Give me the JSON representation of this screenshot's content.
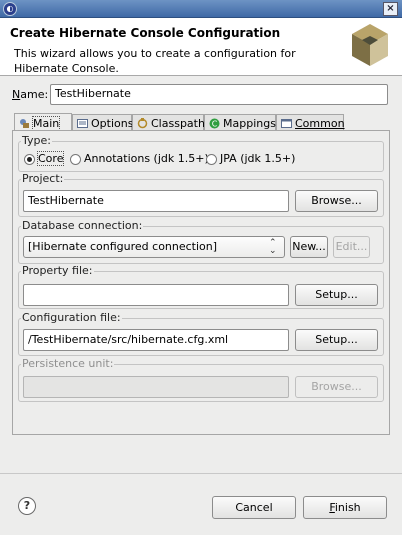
{
  "window": {
    "close_glyph": "×"
  },
  "banner": {
    "title": "Create Hibernate Console Configuration",
    "description": "This wizard allows you to create a configuration for Hibernate Console."
  },
  "name": {
    "label": "Name:",
    "value": "TestHibernate"
  },
  "tabs": [
    {
      "label": "Main",
      "icon": "main-config-icon",
      "active": true
    },
    {
      "label": "Options",
      "icon": "options-icon",
      "active": false
    },
    {
      "label": "Classpath",
      "icon": "classpath-icon",
      "active": false
    },
    {
      "label": "Mappings",
      "icon": "mappings-icon",
      "active": false
    },
    {
      "label": "Common",
      "icon": "common-icon",
      "active": false
    }
  ],
  "type": {
    "label": "Type:",
    "options": [
      "Core",
      "Annotations (jdk 1.5+)",
      "JPA (jdk 1.5+)"
    ],
    "selected": "Core"
  },
  "project": {
    "label": "Project:",
    "value": "TestHibernate",
    "browse_label": "Browse..."
  },
  "database": {
    "label": "Database connection:",
    "value": "[Hibernate configured connection]",
    "new_label": "New...",
    "edit_label": "Edit..."
  },
  "property_file": {
    "label": "Property file:",
    "value": "",
    "setup_label": "Setup..."
  },
  "config_file": {
    "label": "Configuration file:",
    "value": "/TestHibernate/src/hibernate.cfg.xml",
    "setup_label": "Setup..."
  },
  "persistence": {
    "label": "Persistence unit:",
    "value": "",
    "browse_label": "Browse..."
  },
  "footer": {
    "help_glyph": "?",
    "cancel_label": "Cancel",
    "finish_label": "Finish"
  },
  "colors": {
    "titlebar": "#3f69a6",
    "dialog_bg": "#ededec",
    "mappings_icon": "#2e9e3e"
  }
}
